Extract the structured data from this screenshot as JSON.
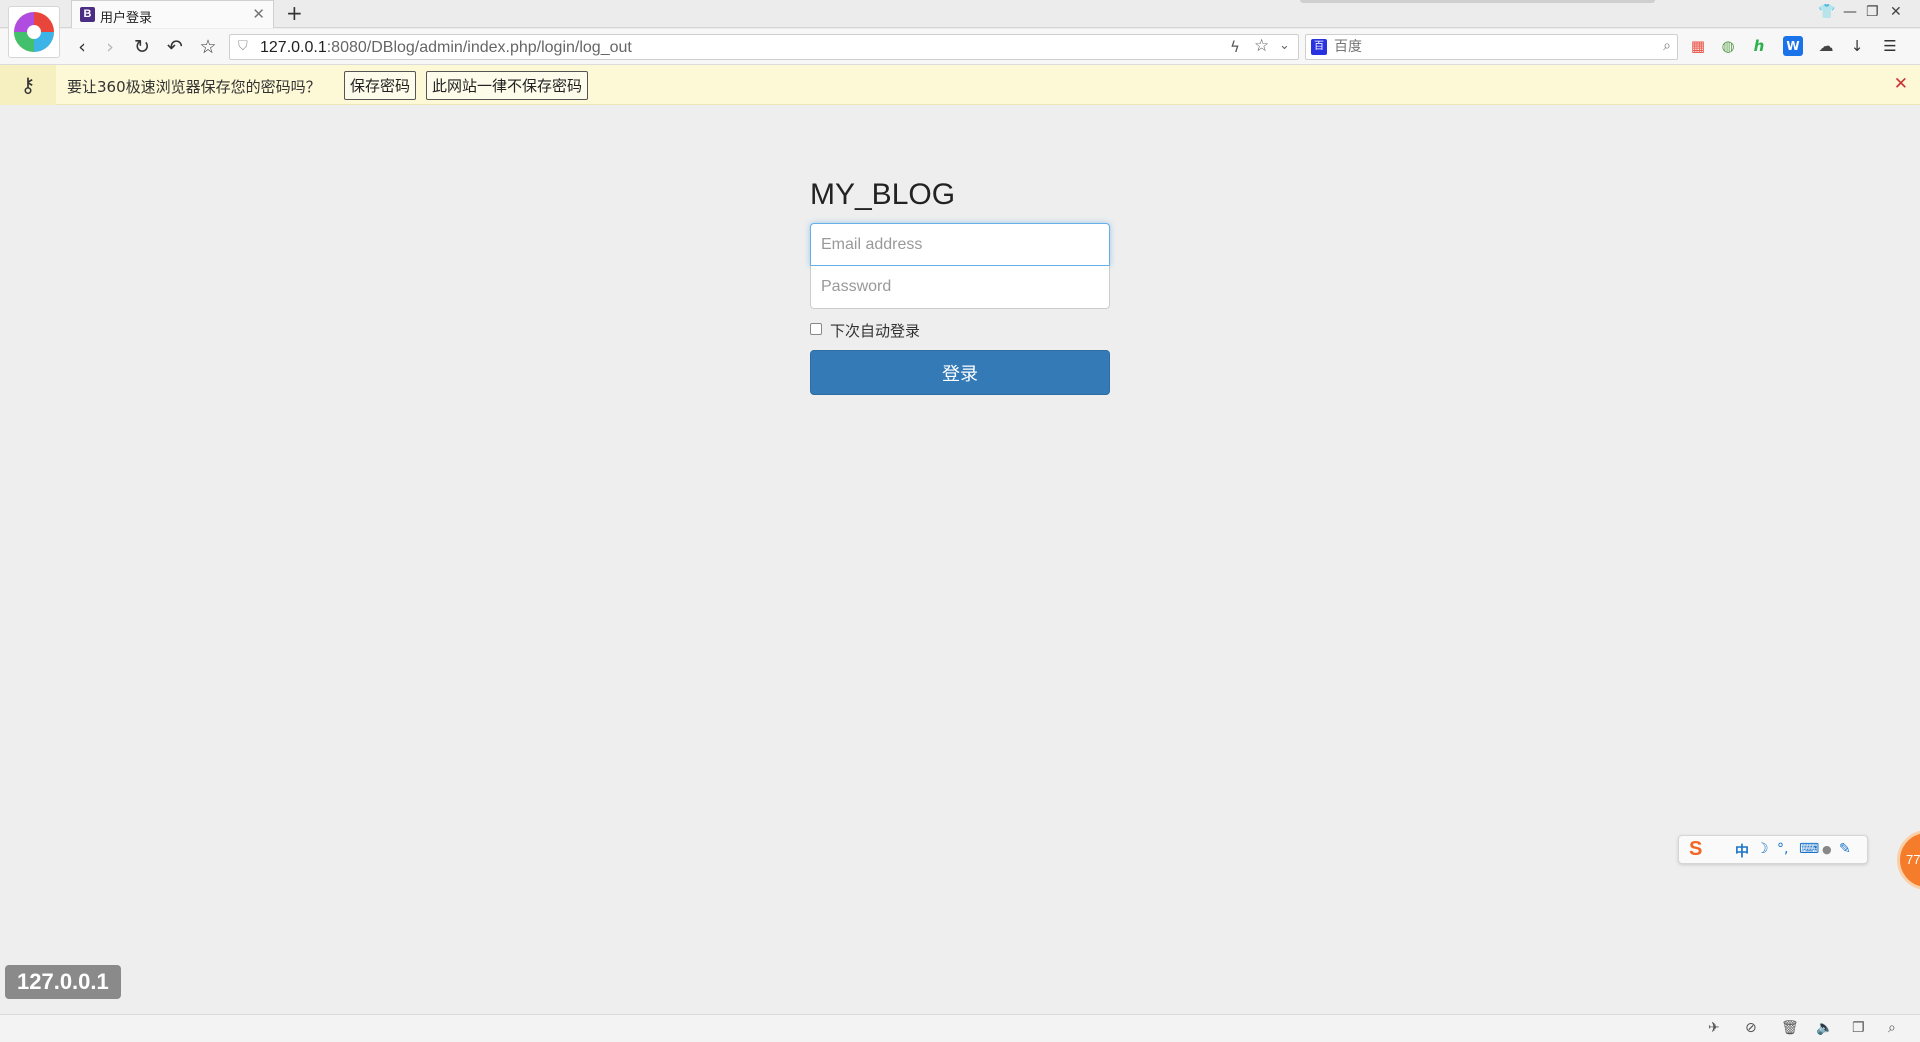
{
  "browser": {
    "tab_title": "用户登录",
    "tab_favicon_letter": "B",
    "url_host": "127.0.0.1",
    "url_rest": ":8080/DBlog/admin/index.php/login/log_out",
    "search_placeholder": "百度",
    "search_engine_letter": "百"
  },
  "password_bar": {
    "message": "要让360极速浏览器保存您的密码吗？",
    "save_label": "保存密码",
    "never_label": "此网站一律不保存密码"
  },
  "login": {
    "brand": "MY_BLOG",
    "email_placeholder": "Email address",
    "password_placeholder": "Password",
    "remember_label": "下次自动登录",
    "submit_label": "登录"
  },
  "ime": {
    "logo": "S",
    "mode": "中",
    "moon": "☽",
    "punct": "°,",
    "keyboard": "⌨",
    "user": "●",
    "tool": "✎"
  },
  "float_ball": "77",
  "hover_url": "127.0.0.1",
  "colors": {
    "primary_button": "#337ab7",
    "page_bg": "#eeeeee",
    "password_bar_bg": "#fdf8d6"
  }
}
